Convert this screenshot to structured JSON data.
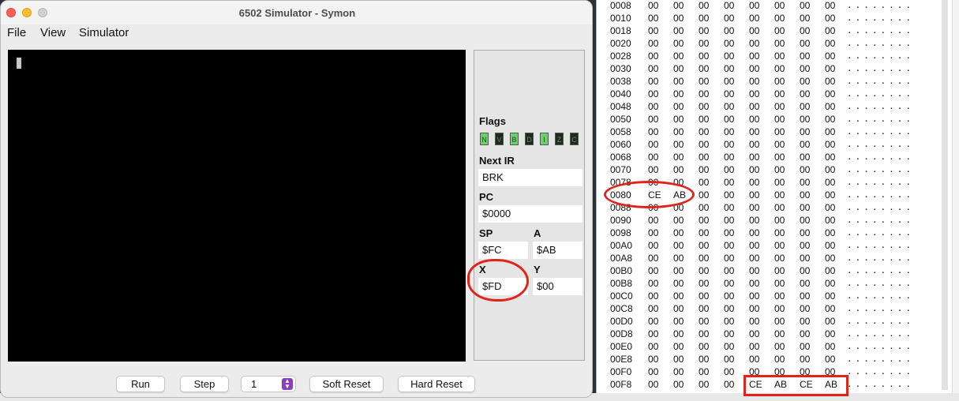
{
  "window": {
    "title": "6502 Simulator - Symon"
  },
  "menu": [
    "File",
    "View",
    "Simulator"
  ],
  "registers": {
    "flags_label": "Flags",
    "flags": [
      {
        "name": "N",
        "on": true
      },
      {
        "name": "V",
        "on": false
      },
      {
        "name": "B",
        "on": true
      },
      {
        "name": "D",
        "on": false
      },
      {
        "name": "I",
        "on": true
      },
      {
        "name": "Z",
        "on": false
      },
      {
        "name": "C",
        "on": false
      }
    ],
    "next_ir_label": "Next IR",
    "next_ir": "BRK",
    "pc_label": "PC",
    "pc": "$0000",
    "sp_label": "SP",
    "sp": "$FC",
    "a_label": "A",
    "a": "$AB",
    "x_label": "X",
    "x": "$FD",
    "y_label": "Y",
    "y": "$00"
  },
  "controls": {
    "run": "Run",
    "step": "Step",
    "step_count": "1",
    "soft_reset": "Soft Reset",
    "hard_reset": "Hard Reset"
  },
  "memory": {
    "rows": [
      {
        "addr": "0008",
        "bytes": [
          "00",
          "00",
          "00",
          "00",
          "00",
          "00",
          "00",
          "00"
        ],
        "ascii": "........"
      },
      {
        "addr": "0010",
        "bytes": [
          "00",
          "00",
          "00",
          "00",
          "00",
          "00",
          "00",
          "00"
        ],
        "ascii": "........"
      },
      {
        "addr": "0018",
        "bytes": [
          "00",
          "00",
          "00",
          "00",
          "00",
          "00",
          "00",
          "00"
        ],
        "ascii": "........"
      },
      {
        "addr": "0020",
        "bytes": [
          "00",
          "00",
          "00",
          "00",
          "00",
          "00",
          "00",
          "00"
        ],
        "ascii": "........"
      },
      {
        "addr": "0028",
        "bytes": [
          "00",
          "00",
          "00",
          "00",
          "00",
          "00",
          "00",
          "00"
        ],
        "ascii": "........"
      },
      {
        "addr": "0030",
        "bytes": [
          "00",
          "00",
          "00",
          "00",
          "00",
          "00",
          "00",
          "00"
        ],
        "ascii": "........"
      },
      {
        "addr": "0038",
        "bytes": [
          "00",
          "00",
          "00",
          "00",
          "00",
          "00",
          "00",
          "00"
        ],
        "ascii": "........"
      },
      {
        "addr": "0040",
        "bytes": [
          "00",
          "00",
          "00",
          "00",
          "00",
          "00",
          "00",
          "00"
        ],
        "ascii": "........"
      },
      {
        "addr": "0048",
        "bytes": [
          "00",
          "00",
          "00",
          "00",
          "00",
          "00",
          "00",
          "00"
        ],
        "ascii": "........"
      },
      {
        "addr": "0050",
        "bytes": [
          "00",
          "00",
          "00",
          "00",
          "00",
          "00",
          "00",
          "00"
        ],
        "ascii": "........"
      },
      {
        "addr": "0058",
        "bytes": [
          "00",
          "00",
          "00",
          "00",
          "00",
          "00",
          "00",
          "00"
        ],
        "ascii": "........"
      },
      {
        "addr": "0060",
        "bytes": [
          "00",
          "00",
          "00",
          "00",
          "00",
          "00",
          "00",
          "00"
        ],
        "ascii": "........"
      },
      {
        "addr": "0068",
        "bytes": [
          "00",
          "00",
          "00",
          "00",
          "00",
          "00",
          "00",
          "00"
        ],
        "ascii": "........"
      },
      {
        "addr": "0070",
        "bytes": [
          "00",
          "00",
          "00",
          "00",
          "00",
          "00",
          "00",
          "00"
        ],
        "ascii": "........"
      },
      {
        "addr": "0078",
        "bytes": [
          "00",
          "00",
          "00",
          "00",
          "00",
          "00",
          "00",
          "00"
        ],
        "ascii": "........"
      },
      {
        "addr": "0080",
        "bytes": [
          "CE",
          "AB",
          "00",
          "00",
          "00",
          "00",
          "00",
          "00"
        ],
        "ascii": "........"
      },
      {
        "addr": "0088",
        "bytes": [
          "00",
          "00",
          "00",
          "00",
          "00",
          "00",
          "00",
          "00"
        ],
        "ascii": "........"
      },
      {
        "addr": "0090",
        "bytes": [
          "00",
          "00",
          "00",
          "00",
          "00",
          "00",
          "00",
          "00"
        ],
        "ascii": "........"
      },
      {
        "addr": "0098",
        "bytes": [
          "00",
          "00",
          "00",
          "00",
          "00",
          "00",
          "00",
          "00"
        ],
        "ascii": "........"
      },
      {
        "addr": "00A0",
        "bytes": [
          "00",
          "00",
          "00",
          "00",
          "00",
          "00",
          "00",
          "00"
        ],
        "ascii": "........"
      },
      {
        "addr": "00A8",
        "bytes": [
          "00",
          "00",
          "00",
          "00",
          "00",
          "00",
          "00",
          "00"
        ],
        "ascii": "........"
      },
      {
        "addr": "00B0",
        "bytes": [
          "00",
          "00",
          "00",
          "00",
          "00",
          "00",
          "00",
          "00"
        ],
        "ascii": "........"
      },
      {
        "addr": "00B8",
        "bytes": [
          "00",
          "00",
          "00",
          "00",
          "00",
          "00",
          "00",
          "00"
        ],
        "ascii": "........"
      },
      {
        "addr": "00C0",
        "bytes": [
          "00",
          "00",
          "00",
          "00",
          "00",
          "00",
          "00",
          "00"
        ],
        "ascii": "........"
      },
      {
        "addr": "00C8",
        "bytes": [
          "00",
          "00",
          "00",
          "00",
          "00",
          "00",
          "00",
          "00"
        ],
        "ascii": "........"
      },
      {
        "addr": "00D0",
        "bytes": [
          "00",
          "00",
          "00",
          "00",
          "00",
          "00",
          "00",
          "00"
        ],
        "ascii": "........"
      },
      {
        "addr": "00D8",
        "bytes": [
          "00",
          "00",
          "00",
          "00",
          "00",
          "00",
          "00",
          "00"
        ],
        "ascii": "........"
      },
      {
        "addr": "00E0",
        "bytes": [
          "00",
          "00",
          "00",
          "00",
          "00",
          "00",
          "00",
          "00"
        ],
        "ascii": "........"
      },
      {
        "addr": "00E8",
        "bytes": [
          "00",
          "00",
          "00",
          "00",
          "00",
          "00",
          "00",
          "00"
        ],
        "ascii": "........"
      },
      {
        "addr": "00F0",
        "bytes": [
          "00",
          "00",
          "00",
          "00",
          "00",
          "00",
          "00",
          "00"
        ],
        "ascii": "........"
      },
      {
        "addr": "00F8",
        "bytes": [
          "00",
          "00",
          "00",
          "00",
          "CE",
          "AB",
          "CE",
          "AB"
        ],
        "ascii": "........"
      }
    ]
  },
  "annotation_color": "#e2231a"
}
